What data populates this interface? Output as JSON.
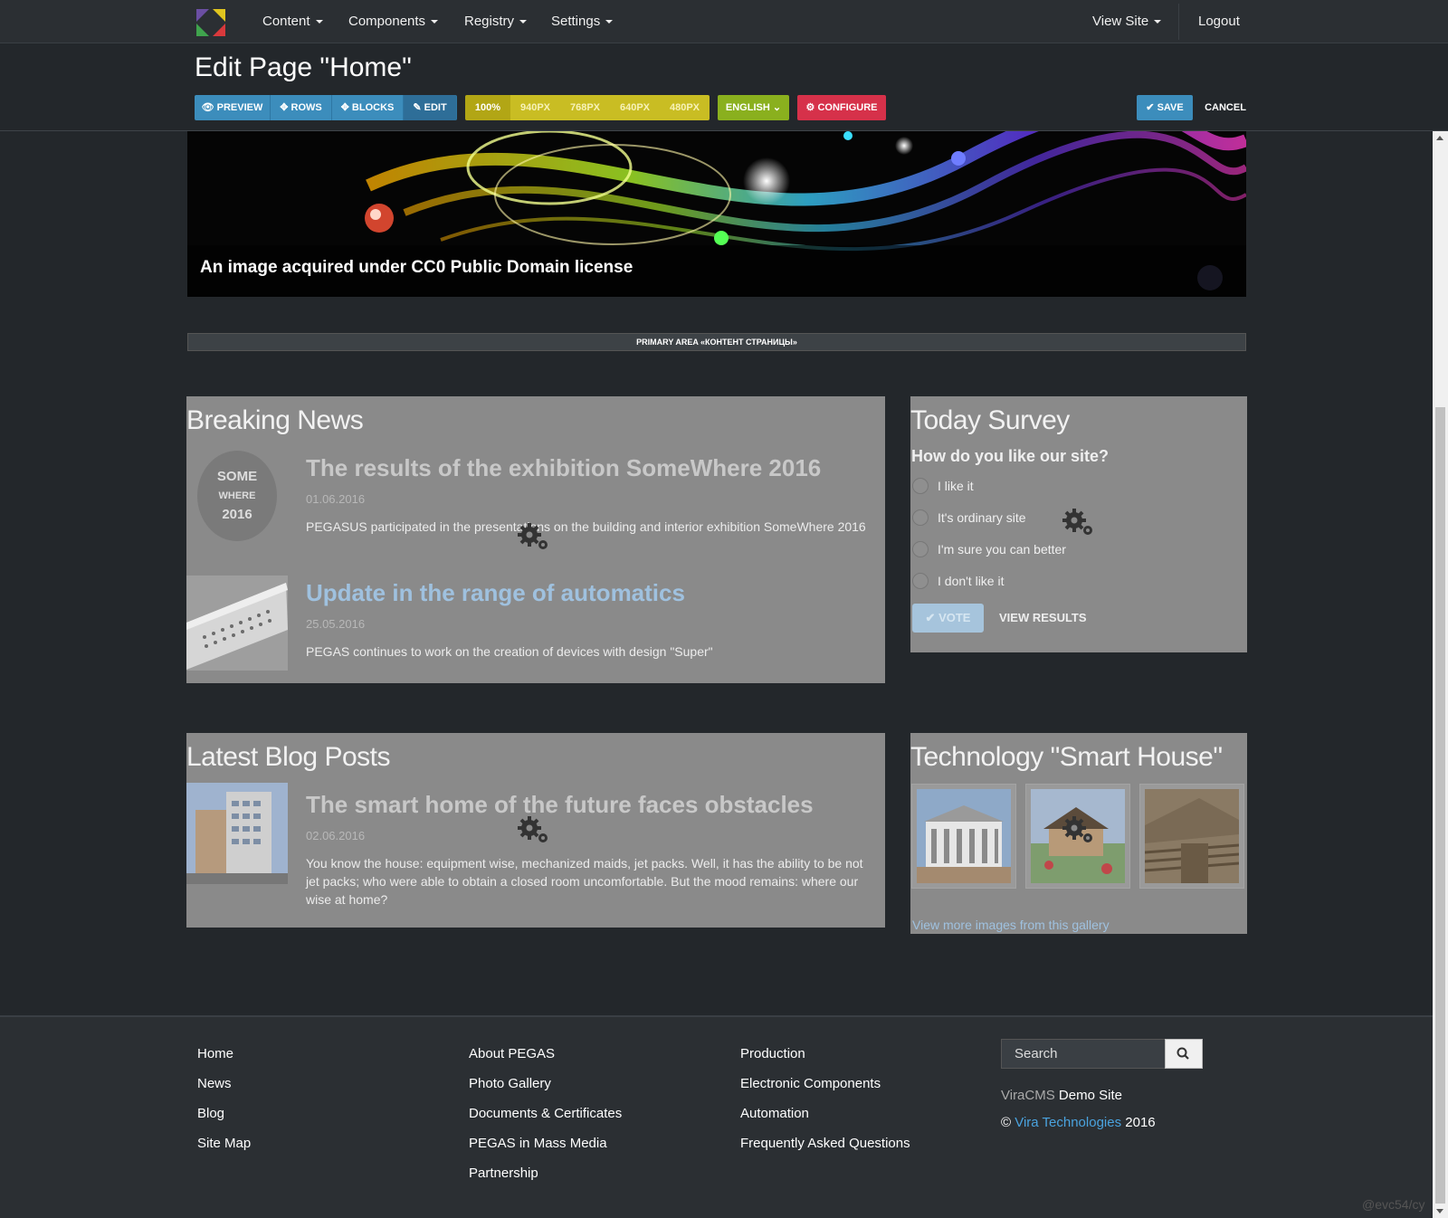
{
  "topnav": {
    "menu": [
      "Content",
      "Components",
      "Registry",
      "Settings"
    ],
    "view_site": "View Site",
    "logout": "Logout"
  },
  "editor": {
    "title": "Edit Page \"Home\"",
    "mode_buttons": [
      "PREVIEW",
      "ROWS",
      "BLOCKS",
      "EDIT"
    ],
    "active_mode": "EDIT",
    "size_buttons": [
      "100%",
      "940PX",
      "768PX",
      "640PX",
      "480PX"
    ],
    "active_size": "100%",
    "language": "ENGLISH",
    "configure": "CONFIGURE",
    "save": "SAVE",
    "cancel": "CANCEL"
  },
  "banner": {
    "caption": "An image acquired under CC0 Public Domain license"
  },
  "primary_area_label": "PRIMARY AREA «КОНТЕНТ СТРАНИЦЫ»",
  "breaking_news": {
    "title": "Breaking News",
    "items": [
      {
        "title": "The results of the exhibition SomeWhere 2016",
        "date": "01.06.2016",
        "text": "PEGASUS participated in the presentations on the building and interior exhibition SomeWhere 2016",
        "thumb_text": [
          "SOME",
          "WHERE",
          "2016"
        ]
      },
      {
        "title": "Update in the range of automatics",
        "date": "25.05.2016",
        "text": "PEGAS continues to work on the creation of devices with design \"Super\""
      }
    ]
  },
  "survey": {
    "title": "Today Survey",
    "question": "How do you like our site?",
    "options": [
      "I like it",
      "It's ordinary site",
      "I'm sure you can better",
      "I don't like it"
    ],
    "vote": "VOTE",
    "view_results": "VIEW RESULTS"
  },
  "blog": {
    "title": "Latest Blog Posts",
    "items": [
      {
        "title": "The smart home of the future faces obstacles",
        "date": "02.06.2016",
        "text": "You know the house: equipment wise, mechanized maids, jet packs. Well, it has the ability to be not jet packs; who were able to obtain a closed room uncomfortable. But the mood remains: where our wise at home?"
      }
    ]
  },
  "smart_house": {
    "title": "Technology \"Smart House\"",
    "link": "View more images from this gallery"
  },
  "footer": {
    "col1": [
      "Home",
      "News",
      "Blog",
      "Site Map"
    ],
    "col2": [
      "About PEGAS",
      "Photo Gallery",
      "Documents & Certificates",
      "PEGAS in Mass Media",
      "Partnership"
    ],
    "col3": [
      "Production",
      "Electronic Components",
      "Automation",
      "Frequently Asked Questions"
    ],
    "search_placeholder": "Search",
    "brand_prefix": "ViraCMS",
    "brand_suffix": "Demo Site",
    "copyright_symbol": "©",
    "company": "Vira Technologies",
    "year": "2016"
  },
  "watermark": "@evc54/cy",
  "colors": {
    "primary_blue": "#3c8dbc",
    "yellow": "#c9bd23",
    "green": "#8ab01e",
    "red": "#d6314a",
    "panel_grey": "#8a8a8a",
    "background": "#23272b"
  }
}
